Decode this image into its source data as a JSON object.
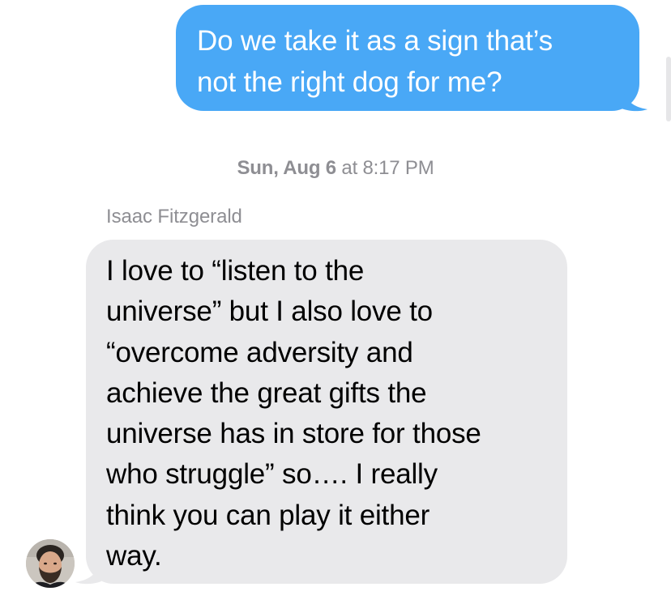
{
  "conversation": {
    "outgoing_message": {
      "lines": [
        "Do we take it as a sign that’s",
        "not the right dog for me?"
      ],
      "bubble_color": "#49a8f6"
    },
    "timestamp": {
      "day": "Sun, Aug 6",
      "connector": "at",
      "time": "8:17 PM"
    },
    "incoming_message": {
      "sender_name": "Isaac Fitzgerald",
      "lines": [
        "I love to “listen to the",
        "universe” but I also love to",
        "“overcome adversity and",
        "achieve the great gifts the",
        "universe has in store for those",
        "who struggle” so…. I really",
        "think you can play it either",
        "way."
      ],
      "bubble_color": "#e9e9eb",
      "avatar_icon": "contact-photo"
    }
  }
}
